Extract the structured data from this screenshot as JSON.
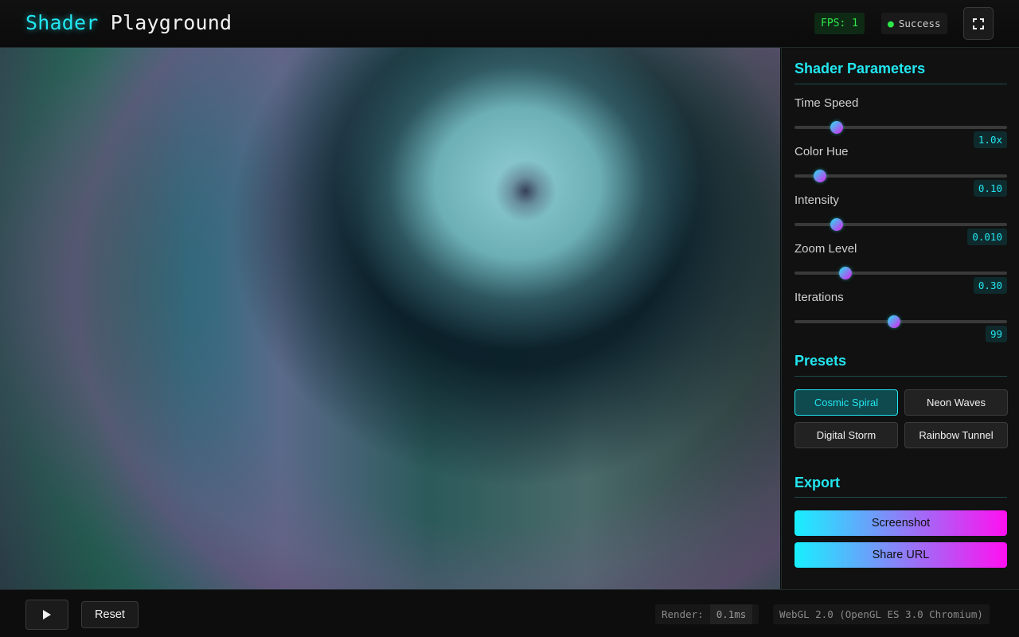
{
  "header": {
    "title_part1": "Shader",
    "title_part2": "Playground",
    "fps": "FPS: 1",
    "status": "Success",
    "fullscreen_icon": "fullscreen-icon"
  },
  "parameters": {
    "title": "Shader Parameters",
    "items": [
      {
        "label": "Time Speed",
        "value": "1.0x",
        "fraction": 0.2
      },
      {
        "label": "Color Hue",
        "value": "0.10",
        "fraction": 0.12
      },
      {
        "label": "Intensity",
        "value": "0.010",
        "fraction": 0.2
      },
      {
        "label": "Zoom Level",
        "value": "0.30",
        "fraction": 0.24
      },
      {
        "label": "Iterations",
        "value": "99",
        "fraction": 0.47
      }
    ]
  },
  "presets": {
    "title": "Presets",
    "items": [
      "Cosmic Spiral",
      "Neon Waves",
      "Digital Storm",
      "Rainbow Tunnel"
    ],
    "active": "Cosmic Spiral"
  },
  "export": {
    "title": "Export",
    "screenshot": " Screenshot",
    "share": " Share URL"
  },
  "footer": {
    "play_icon": "play-icon",
    "reset": "Reset",
    "render_label": "Render:",
    "render_value": "0.1ms",
    "webgl": "WebGL 2.0 (OpenGL ES 3.0 Chromium)"
  },
  "colors": {
    "accent": "#22e6f0",
    "accent2": "#e020f0",
    "success": "#2ee84a"
  }
}
